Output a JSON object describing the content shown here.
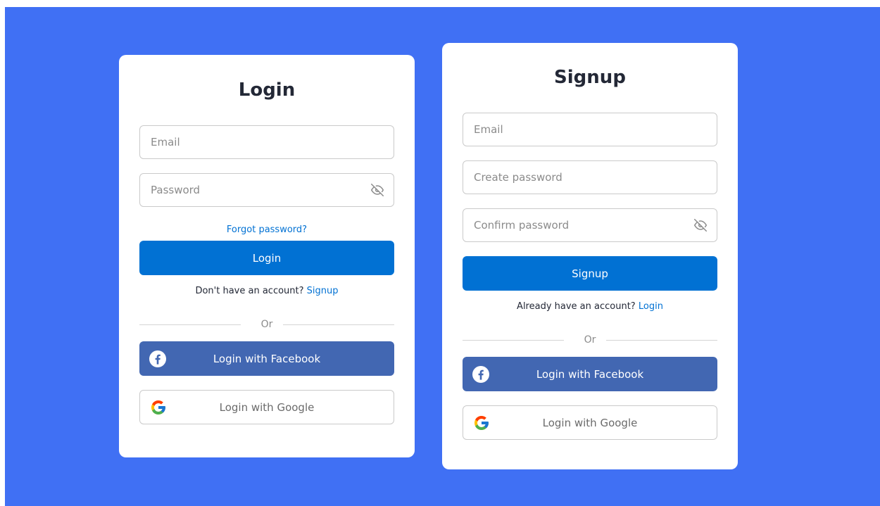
{
  "login": {
    "title": "Login",
    "email_placeholder": "Email",
    "password_placeholder": "Password",
    "forgot_label": "Forgot password?",
    "submit_label": "Login",
    "switch_text": "Don't have an account?",
    "switch_link": "Signup",
    "divider_label": "Or",
    "facebook_label": "Login with Facebook",
    "google_label": "Login with Google"
  },
  "signup": {
    "title": "Signup",
    "email_placeholder": "Email",
    "create_password_placeholder": "Create password",
    "confirm_password_placeholder": "Confirm password",
    "submit_label": "Signup",
    "switch_text": "Already have an account?",
    "switch_link": "Login",
    "divider_label": "Or",
    "facebook_label": "Login with Facebook",
    "google_label": "Login with Google"
  },
  "icons": {
    "password_toggle": "eye-off-icon",
    "facebook": "facebook-icon",
    "google": "google-icon"
  },
  "colors": {
    "background": "#4070f4",
    "card": "#ffffff",
    "primary": "#0171d3",
    "facebook": "#4267b2",
    "title_text": "#232836"
  }
}
